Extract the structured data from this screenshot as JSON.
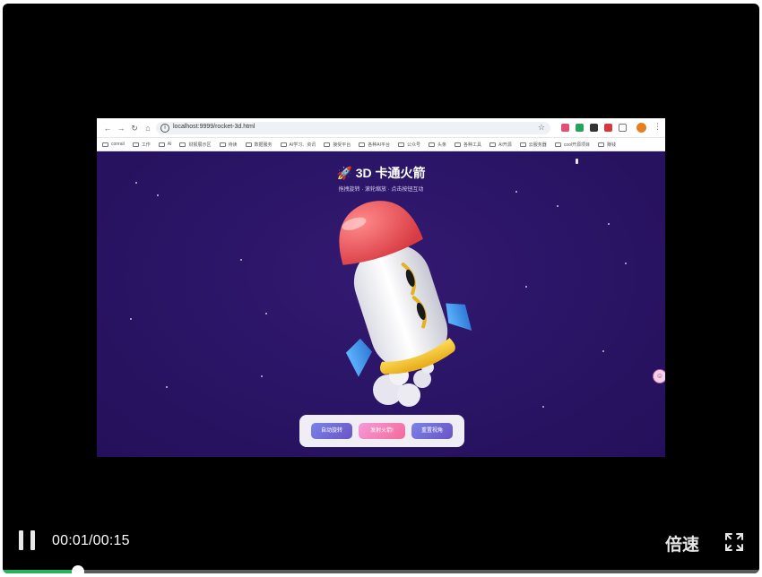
{
  "browser": {
    "url": "localhost:9999/rocket-3d.html",
    "nav_icons": [
      "back-icon",
      "forward-icon",
      "reload-icon",
      "home-icon"
    ],
    "bookmarks": [
      "conrail",
      "工作",
      "AI",
      "财报展示区",
      "待读",
      "数据服务",
      "AI学习、资讯",
      "接受平台",
      "各种AI平台",
      "公众号",
      "头条",
      "各种工具",
      "AI开源",
      "云服务器",
      "cool开源项目",
      "赚钱"
    ]
  },
  "page": {
    "title": "🚀 3D 卡通火箭",
    "subtitle": "拖拽旋转 · 滚轮缩放 · 点击按钮互动",
    "buttons": [
      "自动旋转",
      "发射火箭!",
      "重置视角"
    ]
  },
  "player": {
    "time": "00:01/00:15",
    "speed_label": "倍速",
    "progress": 0.1,
    "accent": "#26b35a"
  }
}
